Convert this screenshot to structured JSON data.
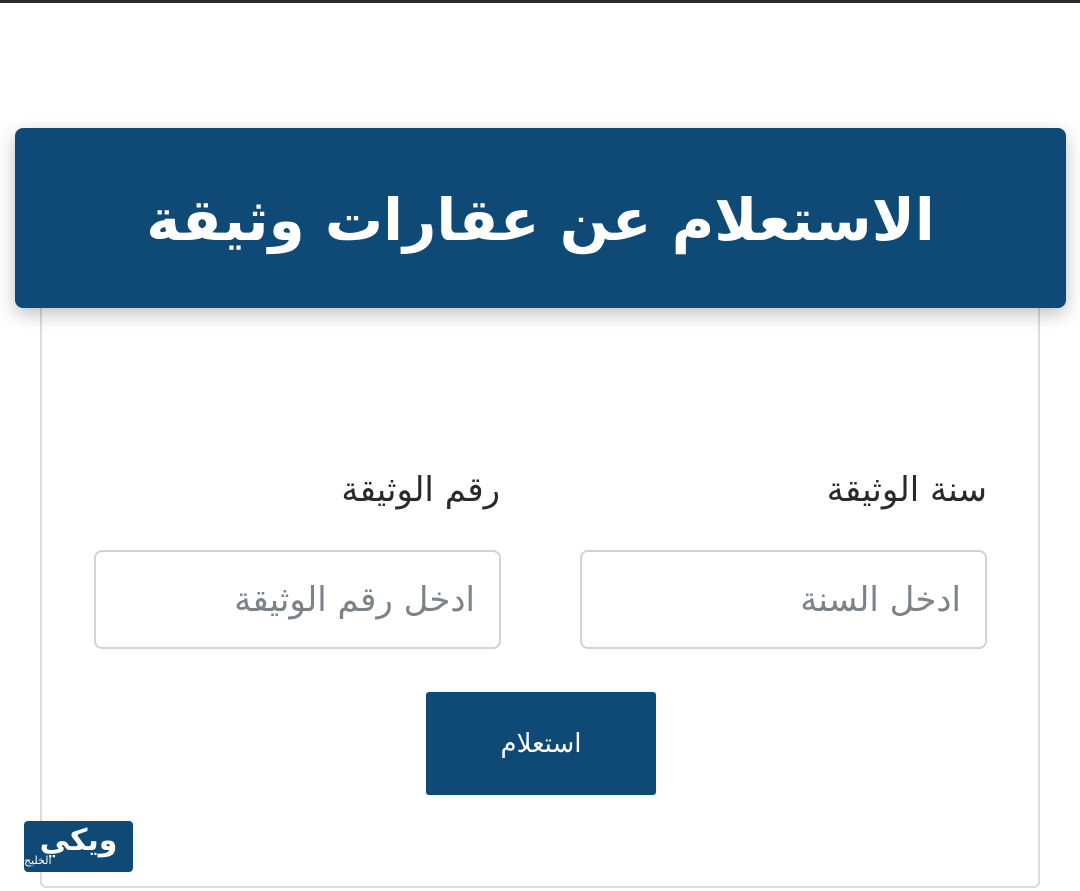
{
  "page": {
    "title": "الاستعلام عن عقارات وثيقة"
  },
  "form": {
    "year_label": "سنة الوثيقة",
    "year_placeholder": "ادخل السنة",
    "year_value": "",
    "number_label": "رقم الوثيقة",
    "number_placeholder": "ادخل رقم الوثيقة",
    "number_value": "",
    "submit_label": "استعلام"
  },
  "watermark": {
    "brand": "ويكي",
    "sub": "الخليج"
  },
  "colors": {
    "primary": "#0e4a75",
    "border": "#cfd4d9",
    "text": "#2a2a2a",
    "placeholder": "#7b8288"
  }
}
